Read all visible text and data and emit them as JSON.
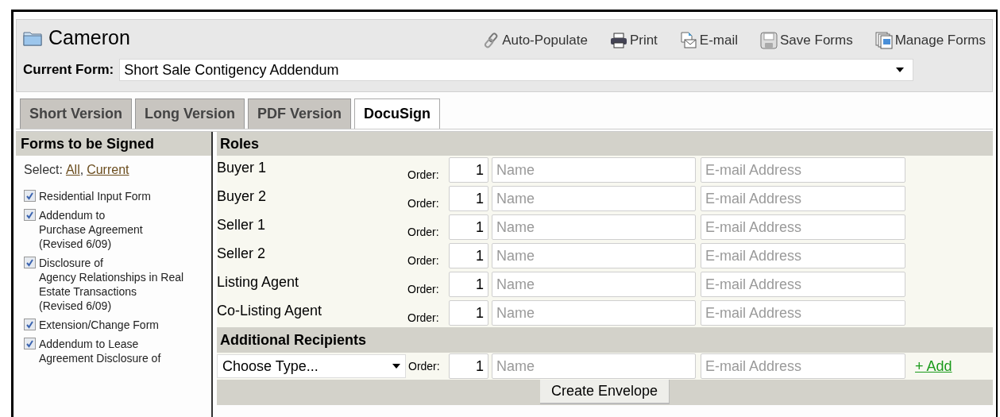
{
  "header": {
    "title": "Cameron",
    "toolbar": [
      {
        "kind": "link",
        "label": "Auto-Populate"
      },
      {
        "kind": "print",
        "label": "Print"
      },
      {
        "kind": "email",
        "label": "E-mail"
      },
      {
        "kind": "save",
        "label": "Save Forms"
      },
      {
        "kind": "manage",
        "label": "Manage Forms"
      }
    ]
  },
  "current_form": {
    "label": "Current Form:",
    "value": "Short Sale Contigency Addendum"
  },
  "tabs": [
    {
      "label": "Short Version",
      "selected": false
    },
    {
      "label": "Long Version",
      "selected": false
    },
    {
      "label": "PDF Version",
      "selected": false
    },
    {
      "label": "DocuSign",
      "selected": true
    }
  ],
  "sidebar": {
    "title": "Forms to be Signed",
    "select_label": "Select:",
    "select_links": [
      "All",
      "Current"
    ],
    "select_separator": ",",
    "items": [
      {
        "lines": [
          "Residential Input Form"
        ],
        "checked": true
      },
      {
        "lines": [
          "Addendum to",
          "Purchase Agreement",
          "(Revised 6/09)"
        ],
        "checked": true
      },
      {
        "lines": [
          "Disclosure of",
          "Agency Relationships in Real",
          "Estate Transactions",
          "(Revised 6/09)"
        ],
        "checked": true
      },
      {
        "lines": [
          "Extension/Change Form"
        ],
        "checked": true
      },
      {
        "lines": [
          "Addendum to Lease",
          "Agreement Disclosure of"
        ],
        "checked": true
      }
    ]
  },
  "roles": {
    "title": "Roles",
    "rows": [
      {
        "role": "Buyer 1",
        "order_label": "Order:",
        "order": "1",
        "name_placeholder": "Name",
        "email_placeholder": "E-mail Address"
      },
      {
        "role": "Buyer 2",
        "order_label": "Order:",
        "order": "1",
        "name_placeholder": "Name",
        "email_placeholder": "E-mail Address"
      },
      {
        "role": "Seller 1",
        "order_label": "Order:",
        "order": "1",
        "name_placeholder": "Name",
        "email_placeholder": "E-mail Address"
      },
      {
        "role": "Seller 2",
        "order_label": "Order:",
        "order": "1",
        "name_placeholder": "Name",
        "email_placeholder": "E-mail Address"
      },
      {
        "role": "Listing Agent",
        "order_label": "Order:",
        "order": "1",
        "name_placeholder": "Name",
        "email_placeholder": "E-mail Address"
      },
      {
        "role": "Co-Listing Agent",
        "order_label": "Order:",
        "order": "1",
        "name_placeholder": "Name",
        "email_placeholder": "E-mail Address"
      }
    ]
  },
  "additional_recipients": {
    "title": "Additional Recipients",
    "type_select": "Choose Type...",
    "order_label": "Order:",
    "order": "1",
    "name_placeholder": "Name",
    "email_placeholder": "E-mail Address",
    "add_link": "+ Add"
  },
  "create_button": "Create Envelope"
}
